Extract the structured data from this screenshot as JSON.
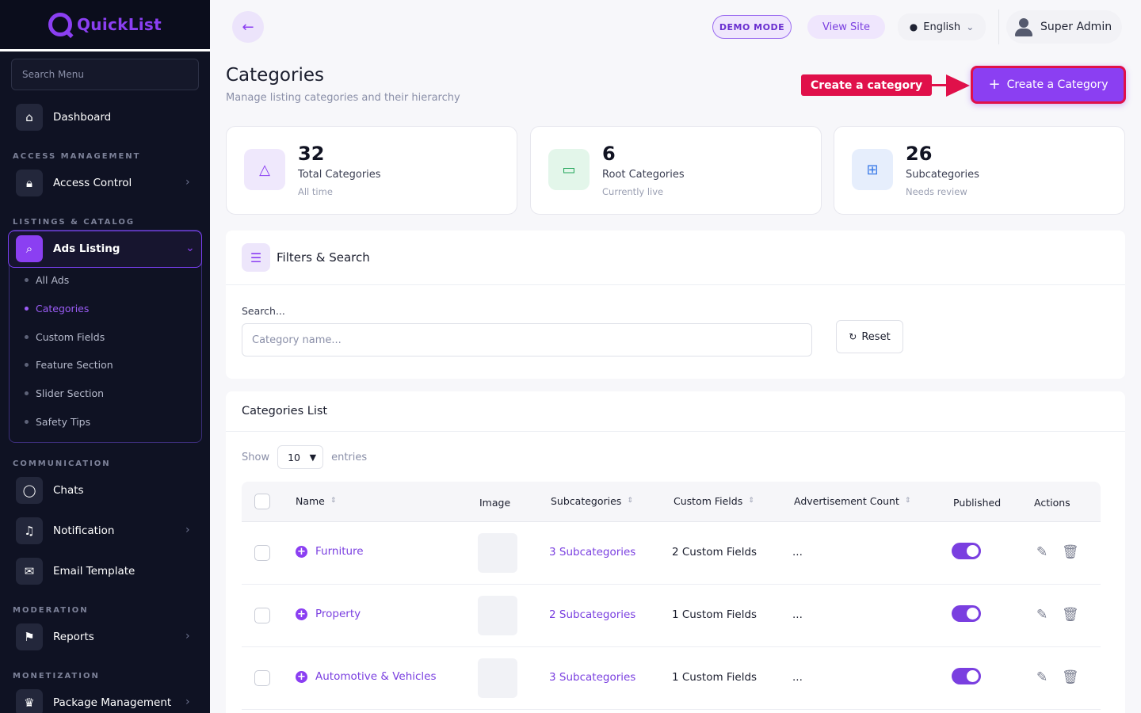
{
  "app": {
    "name": "QuickList"
  },
  "sidebar": {
    "search_placeholder": "Search Menu",
    "dashboard": "Dashboard",
    "sections": {
      "access": "ACCESS MANAGEMENT",
      "listings": "LISTINGS & CATALOG",
      "communication": "COMMUNICATION",
      "moderation": "MODERATION",
      "monetization": "MONETIZATION"
    },
    "access_control": "Access Control",
    "ads_listing": "Ads Listing",
    "ads_sub": [
      "All Ads",
      "Categories",
      "Custom Fields",
      "Feature Section",
      "Slider Section",
      "Safety Tips"
    ],
    "active_sub": "Categories",
    "chats": "Chats",
    "notification": "Notification",
    "email_template": "Email Template",
    "reports": "Reports",
    "package_management": "Package Management"
  },
  "topbar": {
    "demo_mode": "DEMO MODE",
    "view_site": "View Site",
    "language": "English",
    "user_name": "Super Admin"
  },
  "page": {
    "title": "Categories",
    "subtitle": "Manage listing categories and their hierarchy",
    "annotation": "Create a category",
    "create_button": "Create a Category"
  },
  "stats": [
    {
      "value": "32",
      "label": "Total Categories",
      "note": "All time",
      "icon": "shapes-icon"
    },
    {
      "value": "6",
      "label": "Root Categories",
      "note": "Currently live",
      "icon": "folder-icon"
    },
    {
      "value": "26",
      "label": "Subcategories",
      "note": "Needs review",
      "icon": "hierarchy-icon"
    }
  ],
  "filters": {
    "title": "Filters & Search",
    "search_label": "Search...",
    "search_placeholder": "Category name...",
    "search_value": "",
    "reset": "Reset"
  },
  "list": {
    "title": "Categories List",
    "show_label": "Show",
    "entries_value": "10",
    "entries_label": "entries",
    "columns": [
      "Name",
      "Image",
      "Subcategories",
      "Custom Fields",
      "Advertisement Count",
      "Published",
      "Actions"
    ],
    "rows": [
      {
        "name": "Furniture",
        "subcategories": "3 Subcategories",
        "custom_fields": "2 Custom Fields",
        "ad_count": "...",
        "published": true
      },
      {
        "name": "Property",
        "subcategories": "2 Subcategories",
        "custom_fields": "1 Custom Fields",
        "ad_count": "...",
        "published": true
      },
      {
        "name": "Automotive & Vehicles",
        "subcategories": "3 Subcategories",
        "custom_fields": "1 Custom Fields",
        "ad_count": "...",
        "published": true
      }
    ]
  },
  "colors": {
    "accent": "#8b3ff2",
    "sidebar_bg": "#0f1223",
    "annotation": "#e0104a"
  }
}
